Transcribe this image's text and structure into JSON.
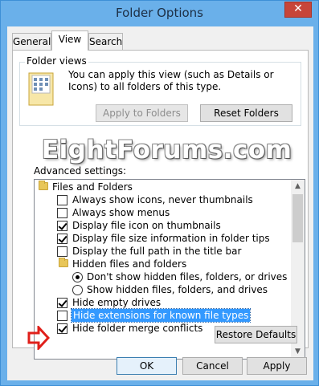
{
  "window": {
    "title": "Folder Options",
    "close_glyph": "✕"
  },
  "tabs": [
    {
      "label": "General"
    },
    {
      "label": "View"
    },
    {
      "label": "Search"
    }
  ],
  "folder_views": {
    "group_label": "Folder views",
    "description": "You can apply this view (such as Details or Icons) to all folders of this type.",
    "apply_button": "Apply to Folders",
    "reset_button": "Reset Folders"
  },
  "watermark": "EightForums.com",
  "advanced": {
    "label": "Advanced settings:",
    "items": [
      {
        "type": "folder",
        "label": "Files and Folders",
        "indent": 0
      },
      {
        "type": "checkbox",
        "label": "Always show icons, never thumbnails",
        "checked": false,
        "indent": 1
      },
      {
        "type": "checkbox",
        "label": "Always show menus",
        "checked": false,
        "indent": 1
      },
      {
        "type": "checkbox",
        "label": "Display file icon on thumbnails",
        "checked": true,
        "indent": 1
      },
      {
        "type": "checkbox",
        "label": "Display file size information in folder tips",
        "checked": true,
        "indent": 1
      },
      {
        "type": "checkbox",
        "label": "Display the full path in the title bar",
        "checked": false,
        "indent": 1
      },
      {
        "type": "folder",
        "label": "Hidden files and folders",
        "indent": 1
      },
      {
        "type": "radio",
        "label": "Don't show hidden files, folders, or drives",
        "selected": true,
        "indent": 2
      },
      {
        "type": "radio",
        "label": "Show hidden files, folders, and drives",
        "selected": false,
        "indent": 2
      },
      {
        "type": "checkbox",
        "label": "Hide empty drives",
        "checked": true,
        "indent": 1
      },
      {
        "type": "checkbox",
        "label": "Hide extensions for known file types",
        "checked": false,
        "indent": 1,
        "highlighted": true
      },
      {
        "type": "checkbox",
        "label": "Hide folder merge conflicts",
        "checked": true,
        "indent": 1
      }
    ],
    "scroll_up_glyph": "▲",
    "scroll_down_glyph": "▼"
  },
  "restore_defaults_button": "Restore Defaults",
  "dialog_buttons": {
    "ok": "OK",
    "cancel": "Cancel",
    "apply": "Apply"
  },
  "colors": {
    "selection": "#3399ff",
    "annotation_arrow": "#e0201b"
  }
}
